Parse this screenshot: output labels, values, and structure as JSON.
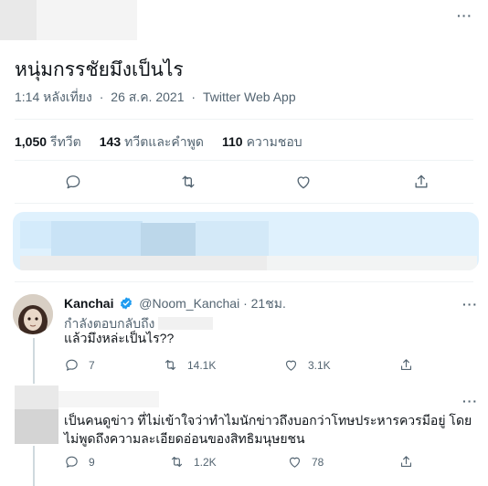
{
  "main_tweet": {
    "text": "หนุ่มกรรชัยมึงเป็นไร",
    "time": "1:14 หลังเที่ยง",
    "date": "26 ส.ค. 2021",
    "source": "Twitter Web App",
    "separator": "·",
    "more": "···",
    "stats": {
      "retweets_count": "1,050",
      "retweets_label": "รีทวีต",
      "quotes_count": "143",
      "quotes_label": "ทวีตและคำพูด",
      "likes_count": "110",
      "likes_label": "ความชอบ"
    }
  },
  "replies": [
    {
      "name": "Kanchai",
      "handle": "@Noom_Kanchai",
      "time": "21ชม.",
      "replying_to": "กำลังตอบกลับถึง",
      "text": "แล้วมึงหล่ะเป็นไร??",
      "reply_count": "7",
      "retweet_count": "14.1K",
      "like_count": "3.1K",
      "more": "···"
    },
    {
      "text": "เป็นคนดูข่าว ที่ไม่เข้าใจว่าทำไมนักข่าวถึงบอกว่าโทษประหารควรมีอยู่ โดยไม่พูดถึงความละเอียดอ่อนของสิทธิมนุษยชน",
      "reply_count": "9",
      "retweet_count": "1.2K",
      "like_count": "78",
      "more": "···"
    }
  ],
  "colors": {
    "text_primary": "#0f1419",
    "text_secondary": "#536471",
    "verified_blue": "#1d9bf0",
    "divider": "#eff3f4"
  }
}
